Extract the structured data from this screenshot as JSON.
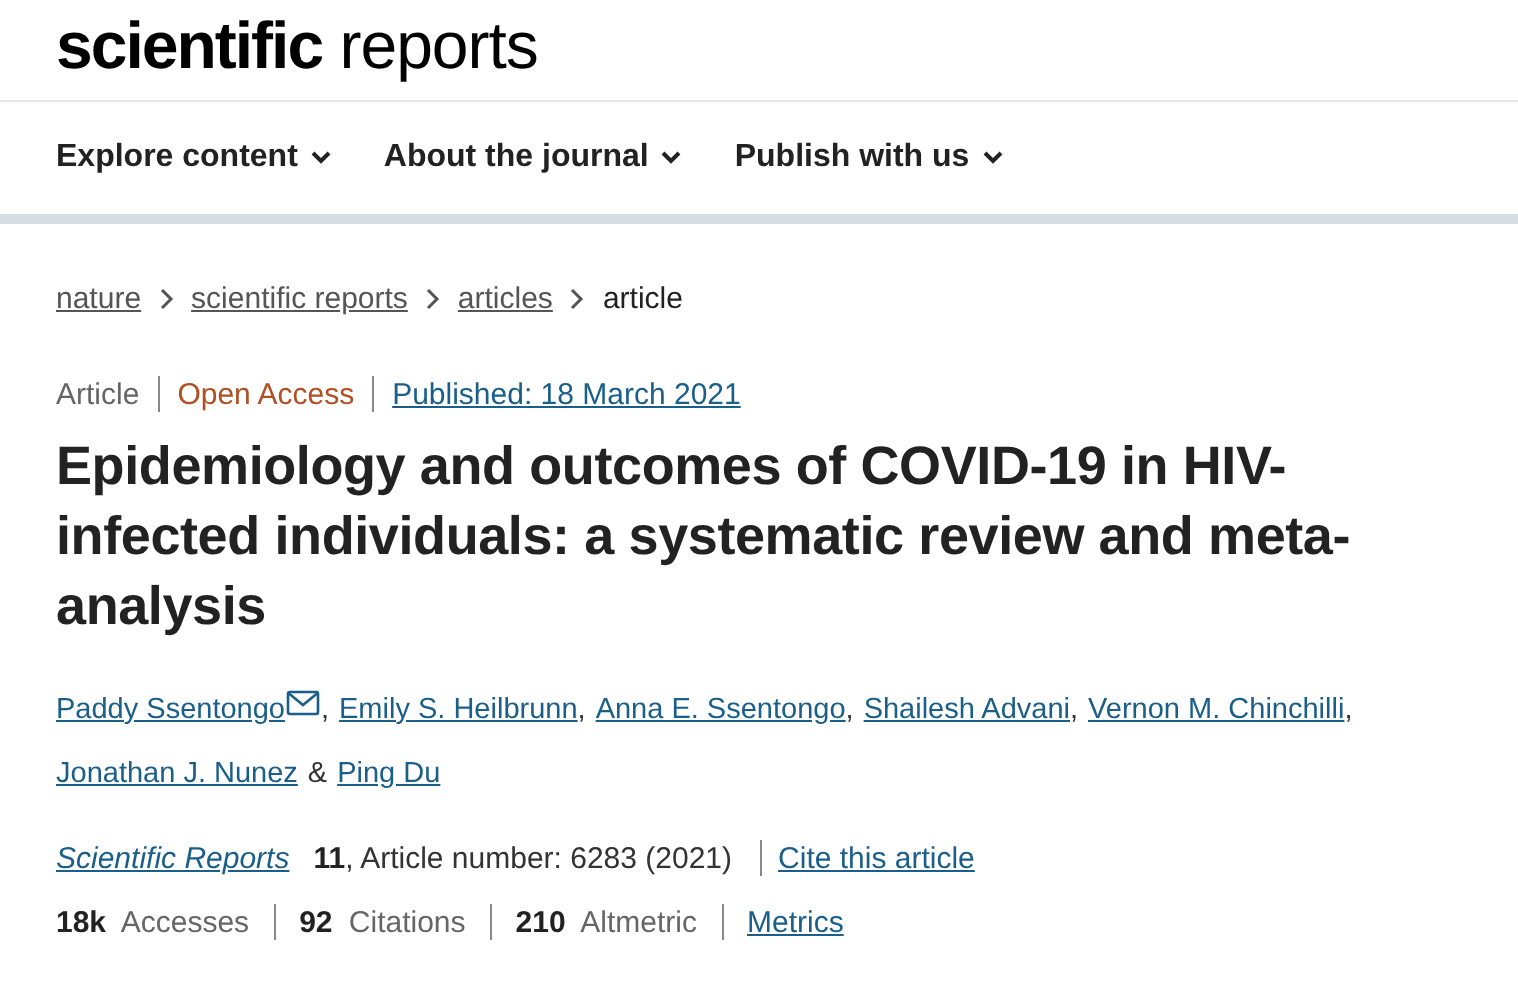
{
  "logo": "**scientific** reports",
  "nav": [
    {
      "label": "Explore content"
    },
    {
      "label": "About the journal"
    },
    {
      "label": "Publish with us"
    }
  ],
  "breadcrumb": [
    {
      "label": "nature",
      "kind": "link"
    },
    {
      "label": "scientific reports",
      "kind": "link"
    },
    {
      "label": "articles",
      "kind": "link"
    },
    {
      "label": "article",
      "kind": "current"
    }
  ],
  "article_meta": [
    {
      "text": "Article",
      "kind": "type"
    },
    {
      "text": "Open Access",
      "kind": "access"
    },
    {
      "text": "Published: 18 March 2021",
      "kind": "link"
    }
  ],
  "title": "Epidemiology and outcomes of COVID-19 in HIV-infected individuals: a systematic review and meta-analysis",
  "authors": [
    {
      "name": "Paddy Ssentongo",
      "corresponding": true,
      "separator": ","
    },
    {
      "name": "Emily S. Heilbrunn",
      "corresponding": false,
      "separator": ","
    },
    {
      "name": "Anna E. Ssentongo",
      "corresponding": false,
      "separator": ","
    },
    {
      "name": "Shailesh Advani",
      "corresponding": false,
      "separator": ","
    },
    {
      "name": "Vernon M. Chinchilli",
      "corresponding": false,
      "separator": ","
    },
    {
      "name": "Jonathan J. Nunez",
      "corresponding": false,
      "separator": "&"
    },
    {
      "name": "Ping Du",
      "corresponding": false
    }
  ],
  "citation": {
    "journal": "Scientific Reports",
    "volume": "11",
    "details": ", Article number: 6283 (2021)",
    "cite_link": "Cite this article"
  },
  "metrics": [
    "**18k** Accesses",
    "**92** Citations",
    "**210** Altmetric"
  ],
  "metrics_link": "Metrics"
}
